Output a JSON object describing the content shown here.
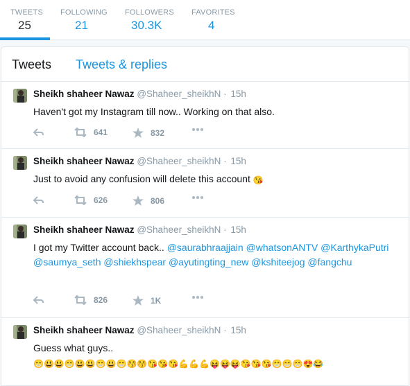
{
  "stats": [
    {
      "label": "TWEETS",
      "value": "25",
      "active": true
    },
    {
      "label": "FOLLOWING",
      "value": "21"
    },
    {
      "label": "FOLLOWERS",
      "value": "30.3K"
    },
    {
      "label": "FAVORITES",
      "value": "4"
    }
  ],
  "tabs": {
    "active": "Tweets",
    "other": "Tweets & replies"
  },
  "tweets": [
    {
      "name": "Sheikh shaheer Nawaz",
      "handle": "@Shaheer_sheikhN",
      "sep": "·",
      "time": "15h",
      "text": "Haven't got my Instagram till now.. Working on that also.",
      "retweets": "641",
      "favorites": "832"
    },
    {
      "name": "Sheikh shaheer Nawaz",
      "handle": "@Shaheer_sheikhN",
      "sep": "·",
      "time": "15h",
      "text": "Just to avoid any confusion will delete this account",
      "emoji": "😘",
      "retweets": "626",
      "favorites": "806"
    },
    {
      "name": "Sheikh shaheer Nawaz",
      "handle": "@Shaheer_sheikhN",
      "sep": "·",
      "time": "15h",
      "text": "I got my Twitter account back..",
      "mentions": [
        "@saurabhraajjain",
        "@whatsonANTV",
        "@KarthykaPutri",
        "@saumya_seth",
        "@shiekhspear",
        "@ayutingting_new",
        "@kshiteejog",
        "@fangchu"
      ],
      "retweets": "826",
      "favorites": "1K"
    },
    {
      "name": "Sheikh shaheer Nawaz",
      "handle": "@Shaheer_sheikhN",
      "sep": "·",
      "time": "15h",
      "text": "Guess what guys..",
      "emoji": "😁😃😃😁😃😃😁😃😁😚😚😘😘😘💪💪💪😝😝😝😘😘😘😁😁😁😍😂"
    }
  ],
  "colors": {
    "accent": "#1b95e0",
    "muted": "#8899a6",
    "border": "#e1e8ed"
  },
  "icons": [
    "reply-icon",
    "retweet-icon",
    "favorite-star-icon",
    "more-icon"
  ]
}
